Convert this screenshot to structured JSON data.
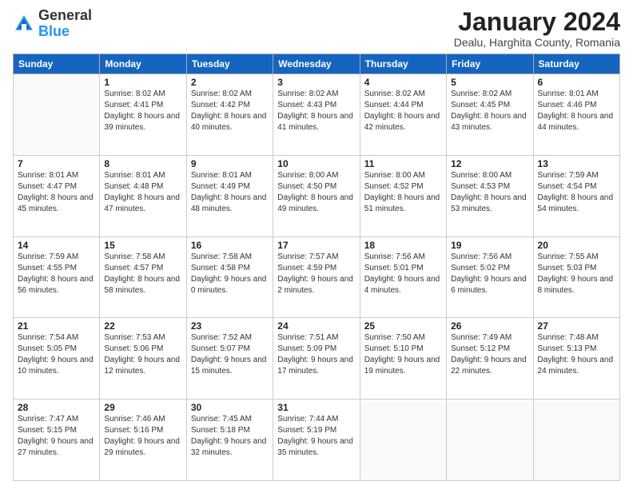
{
  "logo": {
    "general": "General",
    "blue": "Blue"
  },
  "title": "January 2024",
  "subtitle": "Dealu, Harghita County, Romania",
  "days_header": [
    "Sunday",
    "Monday",
    "Tuesday",
    "Wednesday",
    "Thursday",
    "Friday",
    "Saturday"
  ],
  "weeks": [
    [
      {
        "num": "",
        "sunrise": "",
        "sunset": "",
        "daylight": ""
      },
      {
        "num": "1",
        "sunrise": "Sunrise: 8:02 AM",
        "sunset": "Sunset: 4:41 PM",
        "daylight": "Daylight: 8 hours and 39 minutes."
      },
      {
        "num": "2",
        "sunrise": "Sunrise: 8:02 AM",
        "sunset": "Sunset: 4:42 PM",
        "daylight": "Daylight: 8 hours and 40 minutes."
      },
      {
        "num": "3",
        "sunrise": "Sunrise: 8:02 AM",
        "sunset": "Sunset: 4:43 PM",
        "daylight": "Daylight: 8 hours and 41 minutes."
      },
      {
        "num": "4",
        "sunrise": "Sunrise: 8:02 AM",
        "sunset": "Sunset: 4:44 PM",
        "daylight": "Daylight: 8 hours and 42 minutes."
      },
      {
        "num": "5",
        "sunrise": "Sunrise: 8:02 AM",
        "sunset": "Sunset: 4:45 PM",
        "daylight": "Daylight: 8 hours and 43 minutes."
      },
      {
        "num": "6",
        "sunrise": "Sunrise: 8:01 AM",
        "sunset": "Sunset: 4:46 PM",
        "daylight": "Daylight: 8 hours and 44 minutes."
      }
    ],
    [
      {
        "num": "7",
        "sunrise": "Sunrise: 8:01 AM",
        "sunset": "Sunset: 4:47 PM",
        "daylight": "Daylight: 8 hours and 45 minutes."
      },
      {
        "num": "8",
        "sunrise": "Sunrise: 8:01 AM",
        "sunset": "Sunset: 4:48 PM",
        "daylight": "Daylight: 8 hours and 47 minutes."
      },
      {
        "num": "9",
        "sunrise": "Sunrise: 8:01 AM",
        "sunset": "Sunset: 4:49 PM",
        "daylight": "Daylight: 8 hours and 48 minutes."
      },
      {
        "num": "10",
        "sunrise": "Sunrise: 8:00 AM",
        "sunset": "Sunset: 4:50 PM",
        "daylight": "Daylight: 8 hours and 49 minutes."
      },
      {
        "num": "11",
        "sunrise": "Sunrise: 8:00 AM",
        "sunset": "Sunset: 4:52 PM",
        "daylight": "Daylight: 8 hours and 51 minutes."
      },
      {
        "num": "12",
        "sunrise": "Sunrise: 8:00 AM",
        "sunset": "Sunset: 4:53 PM",
        "daylight": "Daylight: 8 hours and 53 minutes."
      },
      {
        "num": "13",
        "sunrise": "Sunrise: 7:59 AM",
        "sunset": "Sunset: 4:54 PM",
        "daylight": "Daylight: 8 hours and 54 minutes."
      }
    ],
    [
      {
        "num": "14",
        "sunrise": "Sunrise: 7:59 AM",
        "sunset": "Sunset: 4:55 PM",
        "daylight": "Daylight: 8 hours and 56 minutes."
      },
      {
        "num": "15",
        "sunrise": "Sunrise: 7:58 AM",
        "sunset": "Sunset: 4:57 PM",
        "daylight": "Daylight: 8 hours and 58 minutes."
      },
      {
        "num": "16",
        "sunrise": "Sunrise: 7:58 AM",
        "sunset": "Sunset: 4:58 PM",
        "daylight": "Daylight: 9 hours and 0 minutes."
      },
      {
        "num": "17",
        "sunrise": "Sunrise: 7:57 AM",
        "sunset": "Sunset: 4:59 PM",
        "daylight": "Daylight: 9 hours and 2 minutes."
      },
      {
        "num": "18",
        "sunrise": "Sunrise: 7:56 AM",
        "sunset": "Sunset: 5:01 PM",
        "daylight": "Daylight: 9 hours and 4 minutes."
      },
      {
        "num": "19",
        "sunrise": "Sunrise: 7:56 AM",
        "sunset": "Sunset: 5:02 PM",
        "daylight": "Daylight: 9 hours and 6 minutes."
      },
      {
        "num": "20",
        "sunrise": "Sunrise: 7:55 AM",
        "sunset": "Sunset: 5:03 PM",
        "daylight": "Daylight: 9 hours and 8 minutes."
      }
    ],
    [
      {
        "num": "21",
        "sunrise": "Sunrise: 7:54 AM",
        "sunset": "Sunset: 5:05 PM",
        "daylight": "Daylight: 9 hours and 10 minutes."
      },
      {
        "num": "22",
        "sunrise": "Sunrise: 7:53 AM",
        "sunset": "Sunset: 5:06 PM",
        "daylight": "Daylight: 9 hours and 12 minutes."
      },
      {
        "num": "23",
        "sunrise": "Sunrise: 7:52 AM",
        "sunset": "Sunset: 5:07 PM",
        "daylight": "Daylight: 9 hours and 15 minutes."
      },
      {
        "num": "24",
        "sunrise": "Sunrise: 7:51 AM",
        "sunset": "Sunset: 5:09 PM",
        "daylight": "Daylight: 9 hours and 17 minutes."
      },
      {
        "num": "25",
        "sunrise": "Sunrise: 7:50 AM",
        "sunset": "Sunset: 5:10 PM",
        "daylight": "Daylight: 9 hours and 19 minutes."
      },
      {
        "num": "26",
        "sunrise": "Sunrise: 7:49 AM",
        "sunset": "Sunset: 5:12 PM",
        "daylight": "Daylight: 9 hours and 22 minutes."
      },
      {
        "num": "27",
        "sunrise": "Sunrise: 7:48 AM",
        "sunset": "Sunset: 5:13 PM",
        "daylight": "Daylight: 9 hours and 24 minutes."
      }
    ],
    [
      {
        "num": "28",
        "sunrise": "Sunrise: 7:47 AM",
        "sunset": "Sunset: 5:15 PM",
        "daylight": "Daylight: 9 hours and 27 minutes."
      },
      {
        "num": "29",
        "sunrise": "Sunrise: 7:46 AM",
        "sunset": "Sunset: 5:16 PM",
        "daylight": "Daylight: 9 hours and 29 minutes."
      },
      {
        "num": "30",
        "sunrise": "Sunrise: 7:45 AM",
        "sunset": "Sunset: 5:18 PM",
        "daylight": "Daylight: 9 hours and 32 minutes."
      },
      {
        "num": "31",
        "sunrise": "Sunrise: 7:44 AM",
        "sunset": "Sunset: 5:19 PM",
        "daylight": "Daylight: 9 hours and 35 minutes."
      },
      {
        "num": "",
        "sunrise": "",
        "sunset": "",
        "daylight": ""
      },
      {
        "num": "",
        "sunrise": "",
        "sunset": "",
        "daylight": ""
      },
      {
        "num": "",
        "sunrise": "",
        "sunset": "",
        "daylight": ""
      }
    ]
  ]
}
